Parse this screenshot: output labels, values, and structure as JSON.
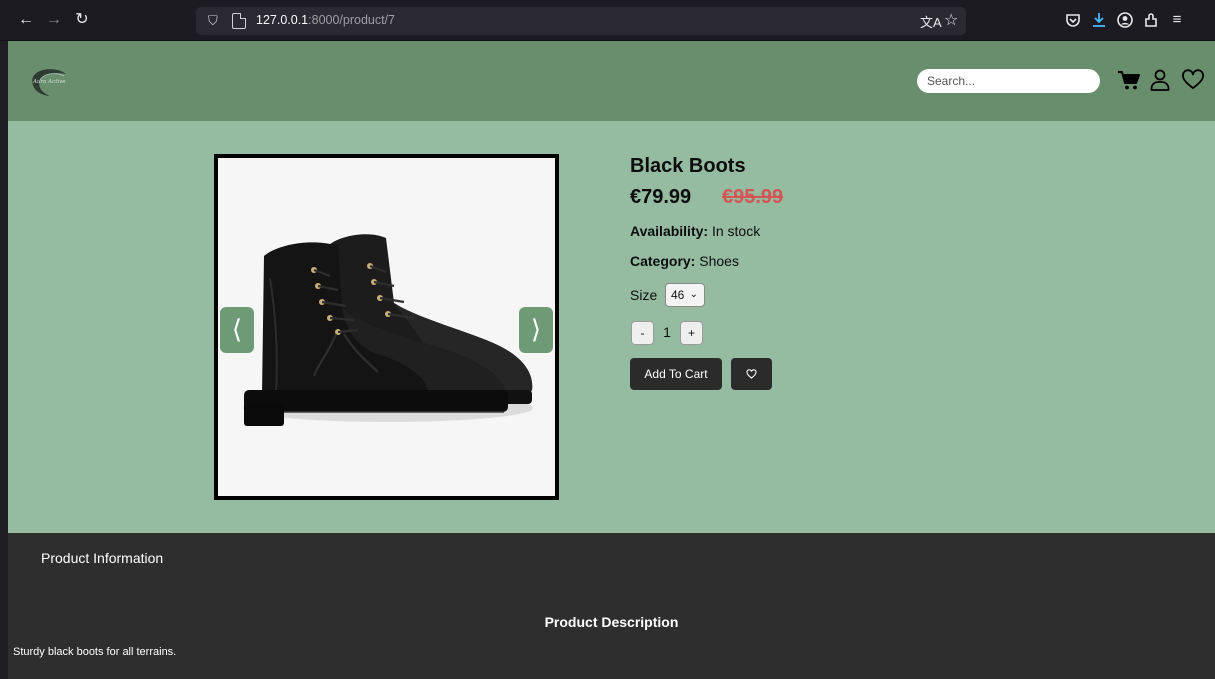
{
  "browser": {
    "url_host": "127.0.0.1",
    "url_path": ":8000/product/7"
  },
  "header": {
    "logo_text": "Aura Active",
    "search_placeholder": "Search..."
  },
  "product": {
    "title": "Black Boots",
    "price": "€79.99",
    "old_price": "€95.99",
    "availability_label": "Availability:",
    "availability_value": "In stock",
    "category_label": "Category:",
    "category_value": "Shoes",
    "size_label": "Size",
    "size_value": "46",
    "qty_minus": "-",
    "qty_value": "1",
    "qty_plus": "+",
    "add_to_cart": "Add To Cart"
  },
  "gallery": {
    "prev_glyph": "⟨",
    "next_glyph": "⟩"
  },
  "info": {
    "tab_label": "Product Information",
    "description_heading": "Product Description",
    "description_text": "Sturdy black boots for all terrains."
  },
  "colors": {
    "header_bg": "#698e6e",
    "main_bg": "#95bca1",
    "footer_bg": "#2e2e2e",
    "old_price": "#d35654",
    "button_dark": "#2b2b2b"
  }
}
